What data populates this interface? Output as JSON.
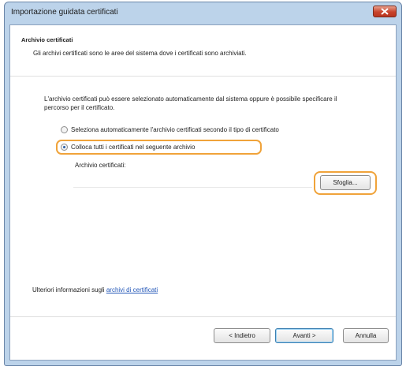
{
  "window": {
    "title": "Importazione guidata certificati"
  },
  "header": {
    "title": "Archivio certificati",
    "description": "Gli archivi certificati sono le aree del sistema dove i certificati sono archiviati."
  },
  "body": {
    "intro": "L'archivio certificati può essere selezionato automaticamente dal sistema oppure è possibile specificare il percorso per il certificato.",
    "options": [
      {
        "label": "Seleziona automaticamente l'archivio certificati secondo il tipo di certificato",
        "selected": false
      },
      {
        "label": "Colloca tutti i certificati nel seguente archivio",
        "selected": true
      }
    ],
    "store_label": "Archivio certificati:",
    "store_value": "",
    "browse_label": "Sfoglia...",
    "more_info_prefix": "Ulteriori informazioni sugli",
    "more_info_link": "archivi di certificati"
  },
  "footer": {
    "back_label": "< Indietro",
    "next_label": "Avanti >",
    "cancel_label": "Annulla"
  },
  "colors": {
    "highlight": "#f0a33a",
    "link": "#2357b8",
    "frame": "#bcd3ea",
    "close_button": "#c8442c"
  }
}
